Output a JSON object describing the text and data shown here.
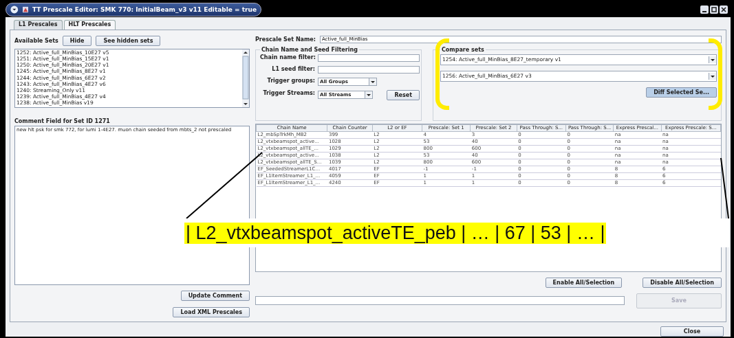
{
  "window": {
    "title": "TT Prescale Editor: SMK 770: InitialBeam_v3 v11 Editable = true"
  },
  "tabs": [
    {
      "label": "L1 Prescales",
      "selected": false
    },
    {
      "label": "HLT Prescales",
      "selected": true
    }
  ],
  "available_sets": {
    "label": "Available Sets",
    "buttons": [
      {
        "label": "Hide"
      },
      {
        "label": "See hidden sets"
      }
    ],
    "items": [
      "1252: Active_full_MinBias_10E27 v5",
      "1251: Active_full_MinBias_15E27 v1",
      "1250: Active_full_MinBias_20E27 v1",
      "1245: Active_full_MinBias_8E27 v1",
      "1244: Active_full_MinBias_6E27 v2",
      "1243: Active_full_MinBias_4E27 v6",
      "1240: Streaming_Only v11",
      "1239: Active_full_MinBias_4E27 v4",
      "1238: Active_full_MinBias v19"
    ]
  },
  "comment": {
    "label": "Comment Field for Set ID 1271",
    "value": "new hlt psk for smk 772, for lumi 1-4E27. muon chain seeded from mbts_2 not prescaled"
  },
  "prescale_set_name": {
    "label": "Prescale Set Name:",
    "value": "Active_full_MinBias"
  },
  "filtering": {
    "title": "Chain Name and Seed Filtering",
    "fields": [
      {
        "kind": "text",
        "label": "Chain name filter:"
      },
      {
        "kind": "text",
        "label": "L1 seed filter:"
      },
      {
        "kind": "dropdown",
        "label": "Trigger groups:",
        "value": "All Groups"
      },
      {
        "kind": "dropdown",
        "label": "Trigger Streams:",
        "value": "All Streams"
      }
    ],
    "reset_button": "Reset"
  },
  "compare_sets": {
    "title": "Compare sets",
    "set_1": "1254: Active_full_MinBias_8E27_temporary v1",
    "set_2": "1256: Active_full_MinBias_6E27 v3",
    "button": "Diff Selected Se..."
  },
  "table": {
    "columns": [
      "Chain Name",
      "Chain Counter",
      "L2 or EF",
      "Prescale: Set 1",
      "Prescale: Set 2",
      "Pass Through: S...",
      "Pass Through: S...",
      "Express Prescal...",
      "Express Prescale: S..."
    ],
    "rows": [
      [
        "L2_mbSpTrkMh_MB2",
        "399",
        "L2",
        "4",
        "3",
        "0",
        "0",
        "na",
        "na"
      ],
      [
        "L2_vtxbeamspot_active...",
        "1028",
        "L2",
        "53",
        "40",
        "0",
        "0",
        "na",
        "na"
      ],
      [
        "L2_vtxbeamspot_allTE_...",
        "1029",
        "L2",
        "800",
        "600",
        "0",
        "0",
        "na",
        "na"
      ],
      [
        "L2_vtxbeamspot_active...",
        "1038",
        "L2",
        "53",
        "40",
        "0",
        "0",
        "na",
        "na"
      ],
      [
        "L2_vtxbeamspot_allTE_S...",
        "1039",
        "L2",
        "800",
        "600",
        "0",
        "0",
        "na",
        "na"
      ],
      [
        "EF_SeededStreamerL1C...",
        "4017",
        "EF",
        "-1",
        "-1",
        "0",
        "0",
        "8",
        "6"
      ],
      [
        "EF_L1ItemStreamer_L1_...",
        "4059",
        "EF",
        "1",
        "1",
        "0",
        "0",
        "8",
        "6"
      ],
      [
        "EF_L1ItemStreamer_L1_...",
        "4240",
        "EF",
        "1",
        "1",
        "0",
        "0",
        "8",
        "6"
      ]
    ]
  },
  "buttons": [
    {
      "label": "Update Comment",
      "disabled": false
    },
    {
      "label": "Load XML Prescales",
      "disabled": false
    },
    {
      "label": "Enable All/Selection",
      "disabled": false
    },
    {
      "label": "Disable All/Selection",
      "disabled": false
    },
    {
      "label": "Save",
      "disabled": true
    },
    {
      "label": "Close",
      "disabled": false
    }
  ],
  "annotation": {
    "callout": "| L2_vtxbeamspot_activeTE_peb | … | 67 | 53 | … |"
  }
}
